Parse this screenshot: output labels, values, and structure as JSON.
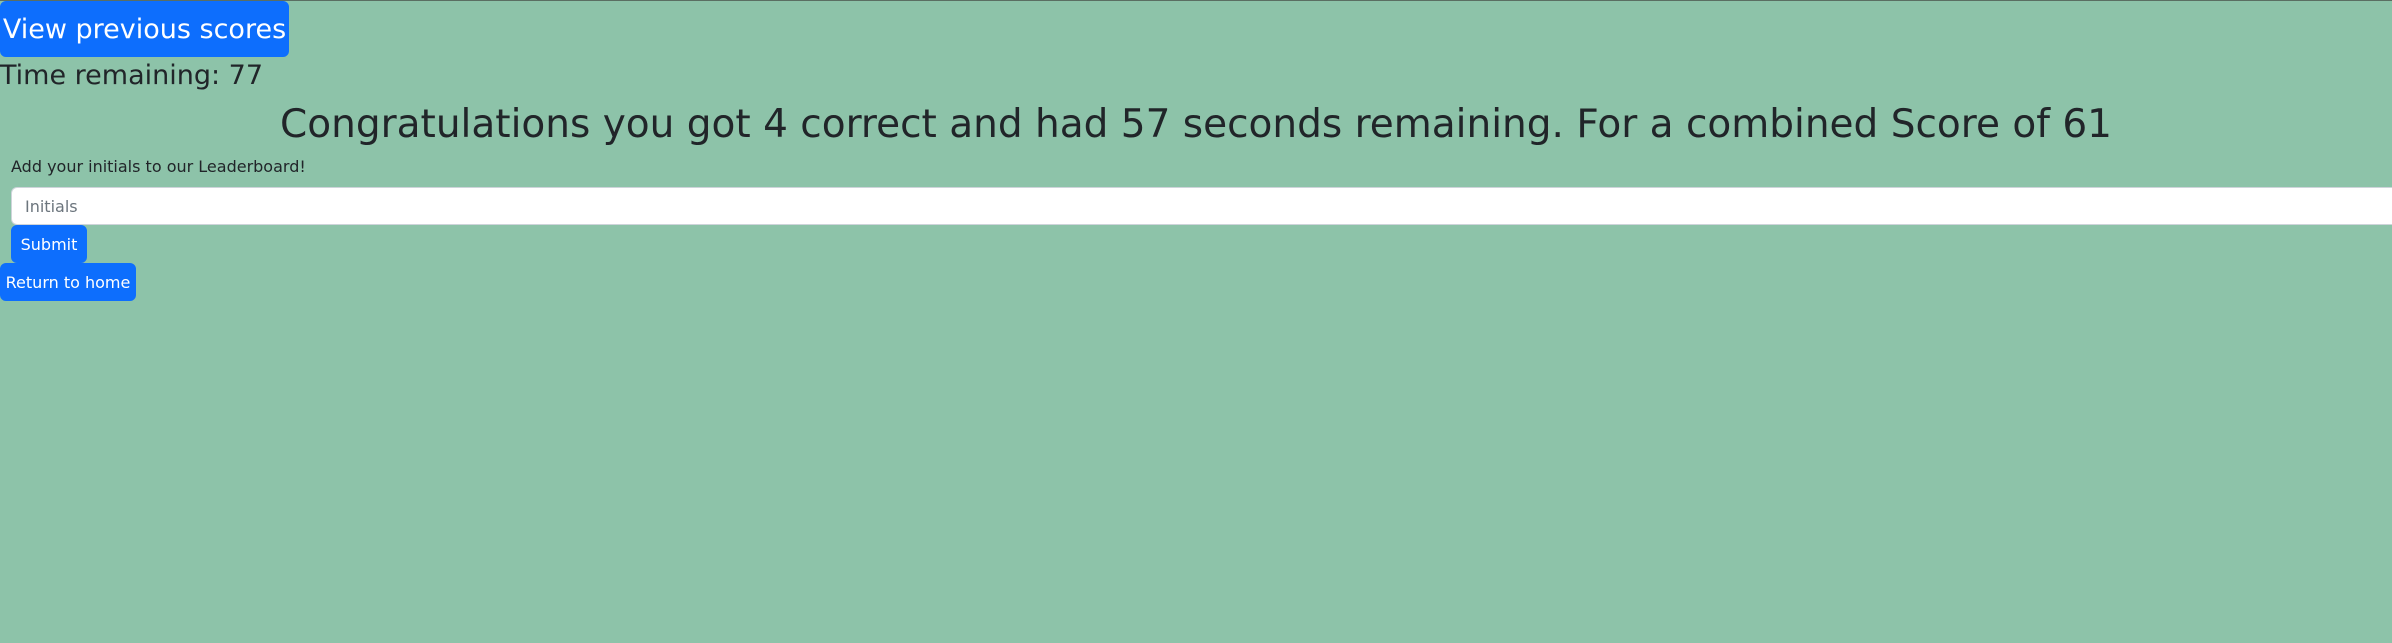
{
  "header": {
    "view_scores_label": "View previous scores",
    "timer_text": "Time remaining: 77"
  },
  "result": {
    "message": "Congratulations you got 4 correct and had 57 seconds remaining. For a combined Score of 61"
  },
  "leaderboard_form": {
    "label": "Add your initials to our Leaderboard!",
    "initials_placeholder": "Initials",
    "initials_value": "",
    "submit_label": "Submit"
  },
  "footer": {
    "home_label": "Return to home"
  },
  "colors": {
    "background": "#8dc3a9",
    "button": "#0d6efd",
    "text": "#212529"
  }
}
